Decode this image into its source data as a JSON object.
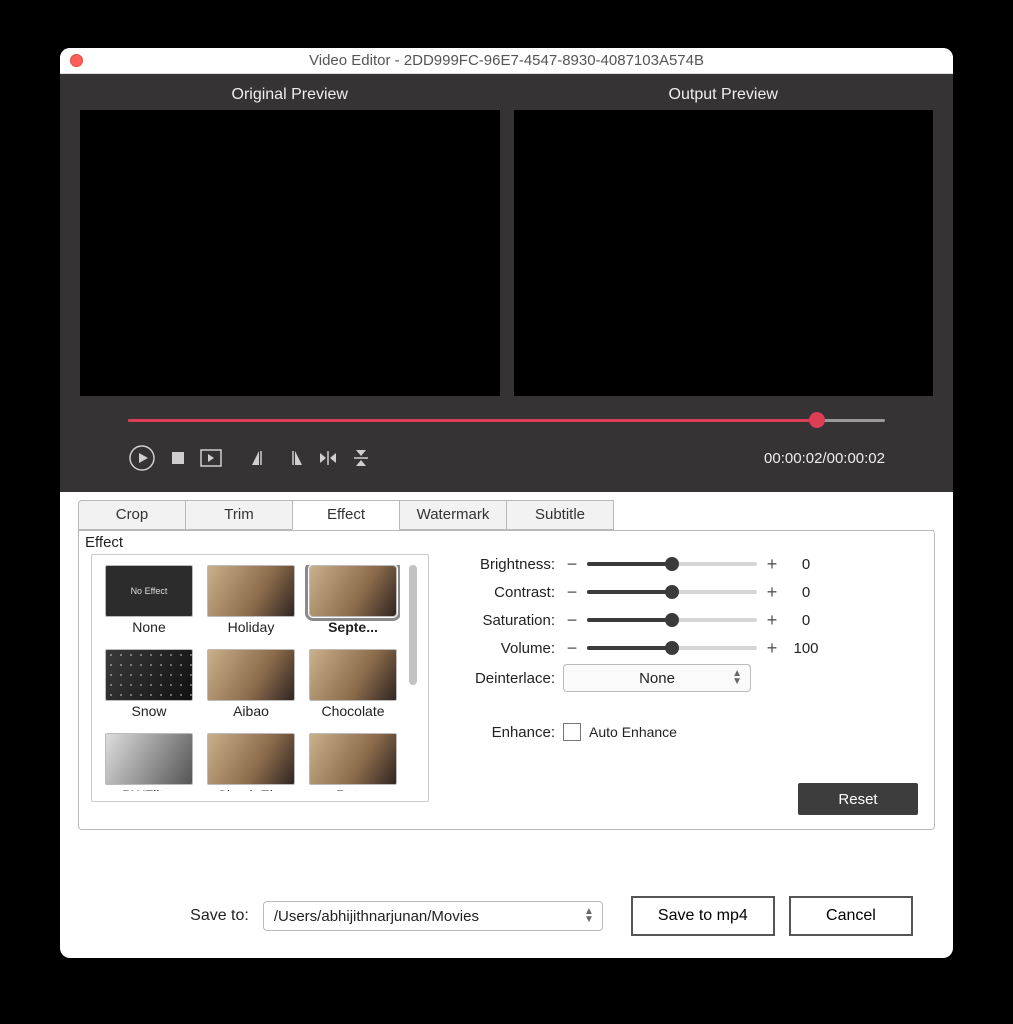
{
  "title": "Video Editor - 2DD999FC-96E7-4547-8930-4087103A574B",
  "preview": {
    "original": "Original Preview",
    "output": "Output Preview"
  },
  "timeline": {
    "progress_pct": 91
  },
  "time": "00:00:02/00:00:02",
  "tabs": [
    "Crop",
    "Trim",
    "Effect",
    "Watermark",
    "Subtitle"
  ],
  "active_tab": "Effect",
  "section_label": "Effect",
  "effects": [
    {
      "label": "None",
      "kind": "no",
      "no_text": "No Effect"
    },
    {
      "label": "Holiday",
      "kind": "img"
    },
    {
      "label": "Septe...",
      "kind": "img",
      "selected": true
    },
    {
      "label": "Snow",
      "kind": "snow"
    },
    {
      "label": "Aibao",
      "kind": "img"
    },
    {
      "label": "Chocolate",
      "kind": "img"
    },
    {
      "label": "BWFilter",
      "kind": "bw"
    },
    {
      "label": "SimpleEl...",
      "kind": "img"
    },
    {
      "label": "Retro",
      "kind": "img"
    }
  ],
  "sliders": {
    "brightness": {
      "label": "Brightness:",
      "value": "0",
      "pct": 50
    },
    "contrast": {
      "label": "Contrast:",
      "value": "0",
      "pct": 50
    },
    "saturation": {
      "label": "Saturation:",
      "value": "0",
      "pct": 50
    },
    "volume": {
      "label": "Volume:",
      "value": "100",
      "pct": 50
    }
  },
  "deinterlace": {
    "label": "Deinterlace:",
    "value": "None"
  },
  "enhance": {
    "label": "Enhance:",
    "option": "Auto Enhance"
  },
  "reset": "Reset",
  "save_to_label": "Save to:",
  "save_path": "/Users/abhijithnarjunan/Movies",
  "save_btn": "Save to mp4",
  "cancel_btn": "Cancel"
}
